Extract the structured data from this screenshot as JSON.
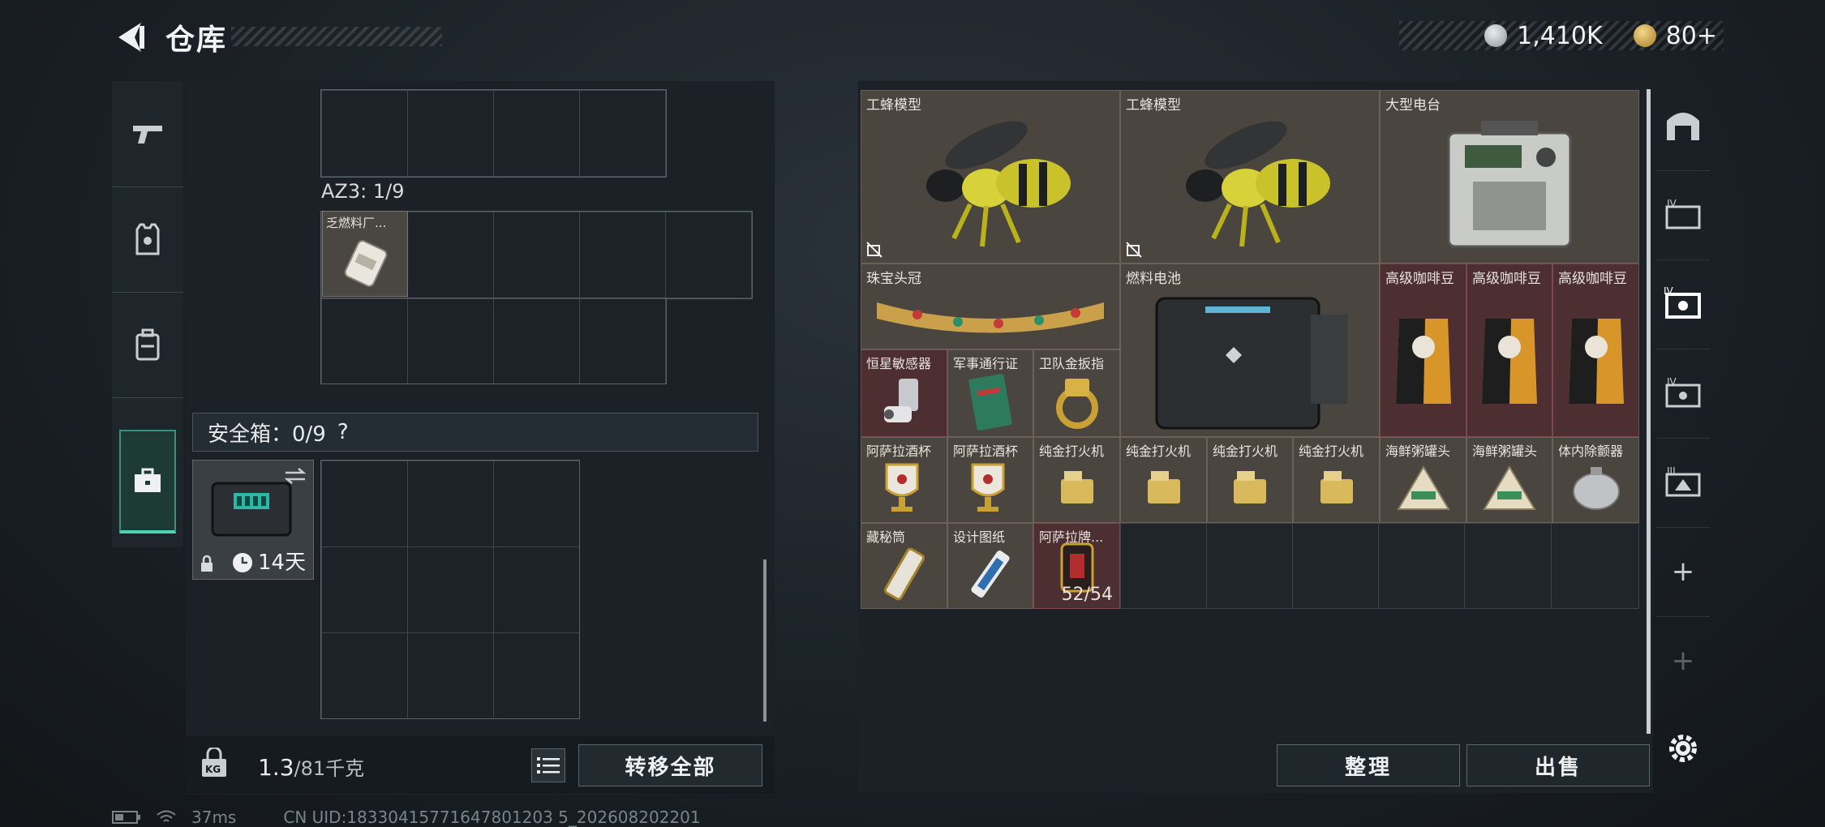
{
  "header": {
    "title": "仓库"
  },
  "currency": {
    "coins": "1,410K",
    "tickets": "80",
    "plus_label": "+"
  },
  "backpack": {
    "container_label": "AZ3: 1/9",
    "fuel_item_name": "乏燃料厂...",
    "safe_box_label": "安全箱：0/9",
    "help_label": "?",
    "safe_box_time": "14天",
    "weight_current": "1.3",
    "weight_max": "/81千克",
    "transfer_all_label": "转移全部",
    "kg_label": "KG"
  },
  "stash": {
    "items": [
      {
        "name": "工蜂模型",
        "count": ""
      },
      {
        "name": "工蜂模型",
        "count": ""
      },
      {
        "name": "大型电台",
        "count": ""
      },
      {
        "name": "珠宝头冠",
        "count": ""
      },
      {
        "name": "燃料电池",
        "count": ""
      },
      {
        "name": "高级咖啡豆",
        "count": ""
      },
      {
        "name": "高级咖啡豆",
        "count": ""
      },
      {
        "name": "高级咖啡豆",
        "count": ""
      },
      {
        "name": "恒星敏感器",
        "count": ""
      },
      {
        "name": "军事通行证",
        "count": ""
      },
      {
        "name": "卫队金扳指",
        "count": ""
      },
      {
        "name": "阿萨拉酒杯",
        "count": ""
      },
      {
        "name": "阿萨拉酒杯",
        "count": ""
      },
      {
        "name": "纯金打火机",
        "count": ""
      },
      {
        "name": "纯金打火机",
        "count": ""
      },
      {
        "name": "纯金打火机",
        "count": ""
      },
      {
        "name": "纯金打火机",
        "count": ""
      },
      {
        "name": "海鲜粥罐头",
        "count": ""
      },
      {
        "name": "海鲜粥罐头",
        "count": ""
      },
      {
        "name": "体内除颤器",
        "count": ""
      },
      {
        "name": "藏秘筒",
        "count": ""
      },
      {
        "name": "设计图纸",
        "count": ""
      },
      {
        "name": "阿萨拉牌...",
        "count": "52/54"
      }
    ],
    "sort_label": "整理",
    "sell_label": "出售"
  },
  "right_nav": {
    "add_label": "+"
  },
  "status_bar": {
    "ping": "37ms",
    "uid": "CN UID:18330415771647801203 5_202608202201"
  },
  "colors": {
    "accent": "#4bd3b3",
    "item_bg": "#4b4540",
    "rare_bg": "#4d2e31"
  }
}
